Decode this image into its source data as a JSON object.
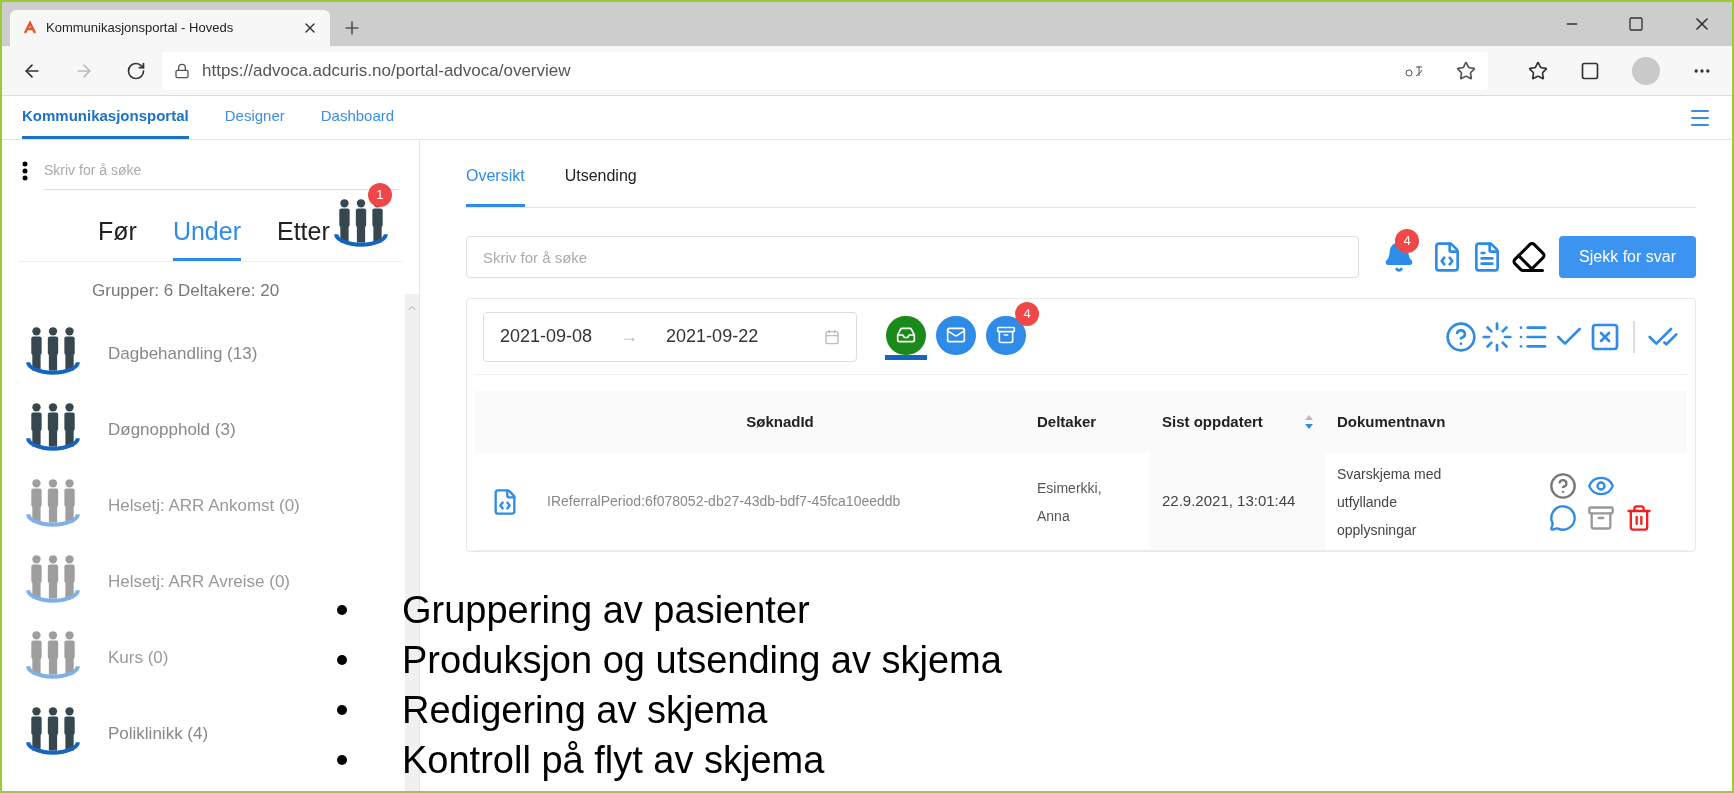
{
  "browser": {
    "tab_title": "Kommunikasjonsportal - Hoveds",
    "url": "https://advoca.adcuris.no/portal-advoca/overview"
  },
  "app_nav": [
    {
      "label": "Kommunikasjonsportal",
      "selected": true
    },
    {
      "label": "Designer",
      "selected": false
    },
    {
      "label": "Dashboard",
      "selected": false
    }
  ],
  "sidebar": {
    "search": {
      "placeholder": "Skriv for å søke"
    },
    "phase_tabs": [
      {
        "label": "Før",
        "selected": false
      },
      {
        "label": "Under",
        "selected": true
      },
      {
        "label": "Etter",
        "selected": false
      }
    ],
    "etter_badge": "1",
    "summary": "Grupper: 6 Deltakere: 20",
    "groups": [
      {
        "label": "Dagbehandling (13)",
        "active": true
      },
      {
        "label": "Døgnopphold (3)",
        "active": true
      },
      {
        "label": "Helsetj: ARR Ankomst (0)",
        "active": false
      },
      {
        "label": "Helsetj: ARR Avreise (0)",
        "active": false
      },
      {
        "label": "Kurs (0)",
        "active": false
      },
      {
        "label": "Poliklinikk (4)",
        "active": true
      }
    ]
  },
  "main": {
    "tabs": [
      {
        "label": "Oversikt",
        "selected": true
      },
      {
        "label": "Utsending",
        "selected": false
      }
    ],
    "search": {
      "placeholder": "Skriv for å søke"
    },
    "bell_badge": "4",
    "check_button": "Sjekk for svar",
    "date_from": "2021-09-08",
    "date_separator": "→",
    "date_to": "2021-09-22",
    "filters": [
      {
        "kind": "received",
        "selected": true
      },
      {
        "kind": "sent",
        "selected": false
      },
      {
        "kind": "archive",
        "selected": false,
        "badge": "4"
      }
    ],
    "table": {
      "columns": [
        {
          "label": "SøknadId",
          "sortable": false
        },
        {
          "label": "Deltaker",
          "sortable": false
        },
        {
          "label": "Sist oppdatert",
          "sortable": true
        },
        {
          "label": "Dokumentnavn",
          "sortable": false
        }
      ],
      "rows": [
        {
          "id": "IReferralPeriod:6f078052-db27-43db-bdf7-45fca10eeddb",
          "deltaker": "Esimerkki, Anna",
          "updated": "22.9.2021, 13:01:44",
          "document": "Svarskjema med utfyllande opplysningar"
        }
      ]
    }
  },
  "bullets": [
    "Gruppering av pasienter",
    "Produksjon og utsending av skjema",
    "Redigering av skjema",
    "Kontroll på flyt av skjema"
  ]
}
